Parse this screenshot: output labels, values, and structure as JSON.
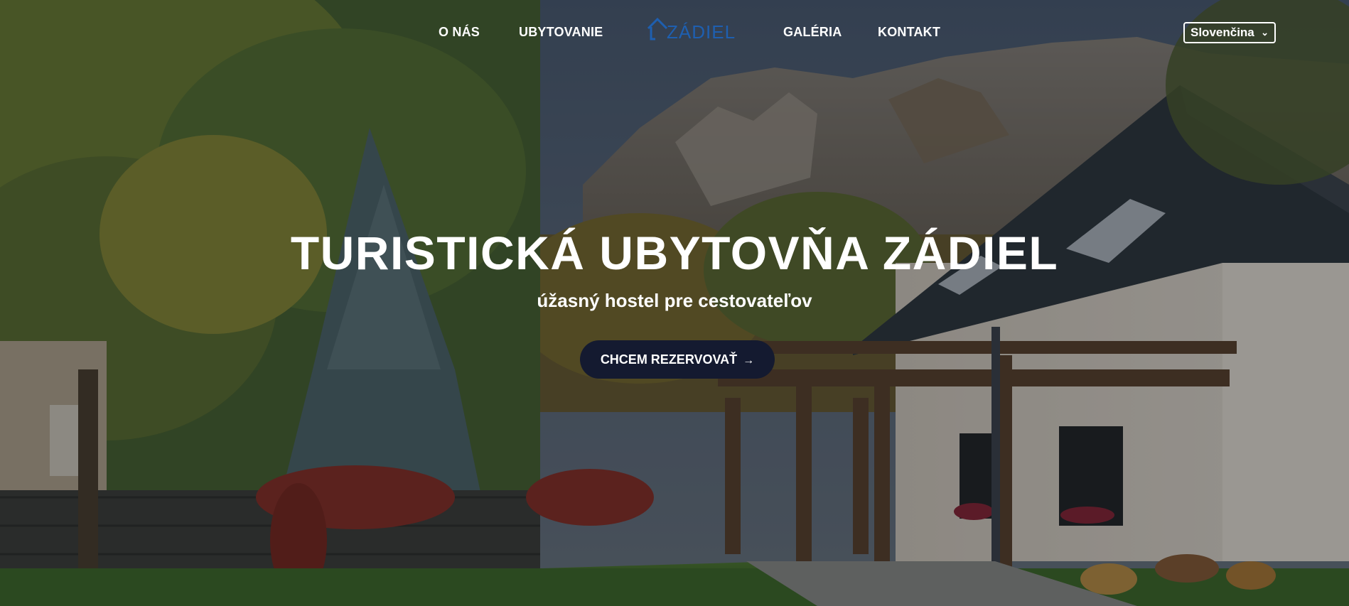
{
  "nav": {
    "items": [
      {
        "label": "O NÁS"
      },
      {
        "label": "UBYTOVANIE"
      },
      {
        "label": "GALÉRIA"
      },
      {
        "label": "KONTAKT"
      }
    ],
    "logo_text": "ZÁDIEL",
    "language": {
      "selected": "Slovenčina"
    }
  },
  "hero": {
    "title": "TURISTICKÁ UBYTOVŇA ZÁDIEL",
    "subtitle": "úžasný hostel pre cestovateľov",
    "cta_label": "CHCEM REZERVOVAŤ",
    "cta_icon": "arrow-right-icon"
  },
  "colors": {
    "logo": "#1e5fb0",
    "cta_background": "#141a30",
    "text": "#ffffff"
  }
}
